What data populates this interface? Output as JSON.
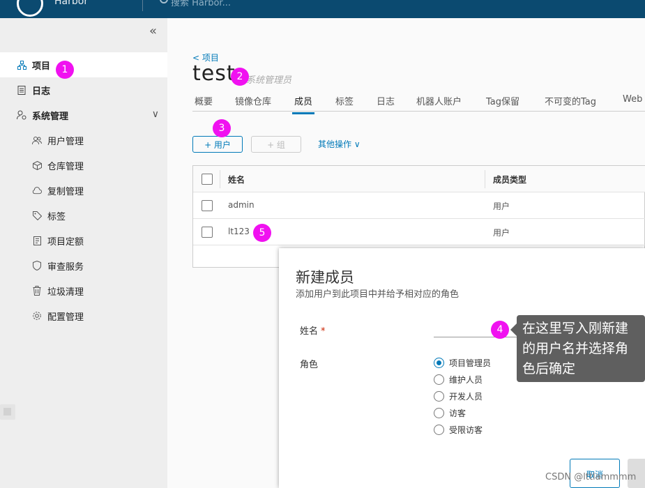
{
  "header": {
    "logo_text": "Harbor",
    "search_placeholder": "搜索 Harbor..."
  },
  "sidebar": {
    "collapse_icon": "double-chevron-left-icon",
    "items": [
      {
        "label": "项目",
        "icon": "project-icon",
        "active": true
      },
      {
        "label": "日志",
        "icon": "log-icon"
      },
      {
        "label": "系统管理",
        "icon": "system-admin-icon"
      }
    ],
    "sub_items": [
      {
        "label": "用户管理",
        "icon": "users-icon"
      },
      {
        "label": "仓库管理",
        "icon": "box-icon"
      },
      {
        "label": "复制管理",
        "icon": "cloud-icon"
      },
      {
        "label": "标签",
        "icon": "tag-icon"
      },
      {
        "label": "项目定额",
        "icon": "quota-icon"
      },
      {
        "label": "审查服务",
        "icon": "shield-icon"
      },
      {
        "label": "垃圾清理",
        "icon": "trash-icon"
      },
      {
        "label": "配置管理",
        "icon": "gear-icon"
      }
    ]
  },
  "project": {
    "back_link": "< 项目",
    "name": "test",
    "role": "系统管理员"
  },
  "tabs": [
    {
      "label": "概要"
    },
    {
      "label": "镜像仓库"
    },
    {
      "label": "成员",
      "active": true
    },
    {
      "label": "标签"
    },
    {
      "label": "日志"
    },
    {
      "label": "机器人账户"
    },
    {
      "label": "Tag保留"
    },
    {
      "label": "不可变的Tag"
    },
    {
      "label": "Web"
    }
  ],
  "toolbar": {
    "add_user": "+ 用户",
    "add_group": "+ 组",
    "more_ops": "其他操作"
  },
  "members_table": {
    "columns": [
      "姓名",
      "成员类型"
    ],
    "rows": [
      {
        "name": "admin",
        "type": "用户"
      },
      {
        "name": "lt123",
        "type": "用户"
      }
    ]
  },
  "modal": {
    "title": "新建成员",
    "subtitle": "添加用户到此项目中并给予相对应的角色",
    "name_label": "姓名",
    "required_mark": "*",
    "role_label": "角色",
    "roles": [
      {
        "label": "项目管理员",
        "checked": true
      },
      {
        "label": "维护人员"
      },
      {
        "label": "开发人员"
      },
      {
        "label": "访客"
      },
      {
        "label": "受限访客"
      }
    ],
    "cancel_label": "取消"
  },
  "annotations": {
    "markers": [
      "1",
      "2",
      "3",
      "4",
      "5"
    ],
    "callout": "在这里写入刚新建的用户名并选择角色后确定",
    "marker_color": "#f011f0"
  },
  "watermark": "CSDN @lttlammmm"
}
